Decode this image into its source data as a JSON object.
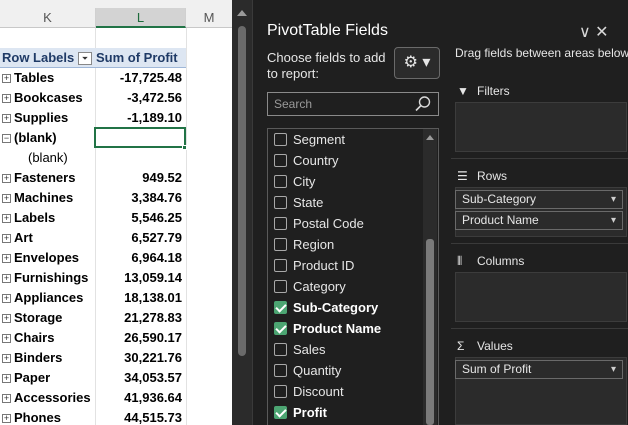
{
  "sheet": {
    "columns": [
      "K",
      "L",
      "M"
    ],
    "header": {
      "row_labels": "Row Labels",
      "sum_label": "Sum of Profit",
      "filter_glyph": "⏷"
    },
    "rows": [
      {
        "label": "Tables",
        "value": "-17,725.48",
        "expander": "+"
      },
      {
        "label": "Bookcases",
        "value": "-3,472.56",
        "expander": "+"
      },
      {
        "label": "Supplies",
        "value": "-1,189.10",
        "expander": "+"
      },
      {
        "label": "(blank)",
        "value": "",
        "expander": "−"
      },
      {
        "label": "(blank)",
        "value": "",
        "expander": "",
        "indent": true
      },
      {
        "label": "Fasteners",
        "value": "949.52",
        "expander": "+"
      },
      {
        "label": "Machines",
        "value": "3,384.76",
        "expander": "+"
      },
      {
        "label": "Labels",
        "value": "5,546.25",
        "expander": "+"
      },
      {
        "label": "Art",
        "value": "6,527.79",
        "expander": "+"
      },
      {
        "label": "Envelopes",
        "value": "6,964.18",
        "expander": "+"
      },
      {
        "label": "Furnishings",
        "value": "13,059.14",
        "expander": "+"
      },
      {
        "label": "Appliances",
        "value": "18,138.01",
        "expander": "+"
      },
      {
        "label": "Storage",
        "value": "21,278.83",
        "expander": "+"
      },
      {
        "label": "Chairs",
        "value": "26,590.17",
        "expander": "+"
      },
      {
        "label": "Binders",
        "value": "30,221.76",
        "expander": "+"
      },
      {
        "label": "Paper",
        "value": "34,053.57",
        "expander": "+"
      },
      {
        "label": "Accessories",
        "value": "41,936.64",
        "expander": "+"
      },
      {
        "label": "Phones",
        "value": "44,515.73",
        "expander": "+"
      }
    ]
  },
  "pane": {
    "title": "PivotTable Fields",
    "title_icons": "∨  ✕",
    "chooser_text": "Choose fields to add to report:",
    "gear_glyph": "⚙ ▾",
    "search_placeholder": "Search",
    "fields": [
      {
        "name": "Segment",
        "checked": false
      },
      {
        "name": "Country",
        "checked": false
      },
      {
        "name": "City",
        "checked": false
      },
      {
        "name": "State",
        "checked": false
      },
      {
        "name": "Postal Code",
        "checked": false
      },
      {
        "name": "Region",
        "checked": false
      },
      {
        "name": "Product ID",
        "checked": false
      },
      {
        "name": "Category",
        "checked": false
      },
      {
        "name": "Sub-Category",
        "checked": true
      },
      {
        "name": "Product Name",
        "checked": true
      },
      {
        "name": "Sales",
        "checked": false
      },
      {
        "name": "Quantity",
        "checked": false
      },
      {
        "name": "Discount",
        "checked": false
      },
      {
        "name": "Profit",
        "checked": true
      }
    ],
    "areas": {
      "hint": "Drag fields between areas below:",
      "filters_label": "Filters",
      "rows_label": "Rows",
      "columns_label": "Columns",
      "values_label": "Values",
      "rows_items": [
        "Sub-Category",
        "Product Name"
      ],
      "values_items": [
        "Sum of Profit"
      ]
    }
  },
  "colors": {
    "accent": "#217346",
    "checkbox": "#4ca572",
    "pane_bg": "#1f1f1f"
  }
}
